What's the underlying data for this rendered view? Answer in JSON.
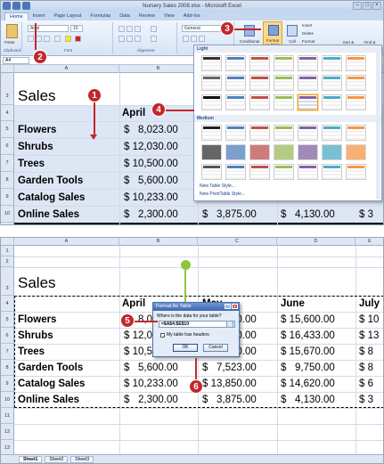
{
  "window": {
    "title": "Nursery Sales 2008.xlsx - Microsoft Excel"
  },
  "tabs": [
    "Home",
    "Insert",
    "Page Layout",
    "Formulas",
    "Data",
    "Review",
    "View",
    "Add-Ins"
  ],
  "ribbon": {
    "paste_label": "Paste",
    "clipboard_group": "Clipboard",
    "font_name": "Arial",
    "font_size": "10",
    "font_group": "Font",
    "alignment_group": "Alignment",
    "number_format": "General",
    "number_group": "Number",
    "conditional_formatting": "Conditional Formatting",
    "format_as_table": "Format as Table",
    "cell_styles": "Cell Styles",
    "insert_label": "Insert",
    "delete_label": "Delete",
    "format_label": "Format",
    "sort_filter": "Sort & Filter",
    "find_select": "Find & Select"
  },
  "formula_bar": {
    "name_box": "A4",
    "fx": "fx"
  },
  "columns": [
    "A",
    "B",
    "C",
    "D",
    "E"
  ],
  "sheet": {
    "title": "Sales",
    "header_row": [
      "April",
      "May",
      "June",
      "July"
    ],
    "rows": [
      {
        "label": "Flowers",
        "values": [
          "$   8,023.00",
          "$ 10,000.00",
          "$ 15,600.00",
          "$ 10"
        ]
      },
      {
        "label": "Shrubs",
        "values": [
          "$ 12,030.00",
          "$ 12,000.00",
          "$ 16,433.00",
          "$ 13"
        ]
      },
      {
        "label": "Trees",
        "values": [
          "$ 10,500.00",
          "$ 10,000.00",
          "$ 15,670.00",
          "$ 8"
        ]
      },
      {
        "label": "Garden Tools",
        "values": [
          "$   5,600.00",
          "$   7,523.00",
          "$   9,750.00",
          "$ 8"
        ]
      },
      {
        "label": "Catalog Sales",
        "values": [
          "$ 10,233.00",
          "$ 13,850.00",
          "$ 14,620.00",
          "$ 6"
        ]
      },
      {
        "label": "Online Sales",
        "values": [
          "$   2,300.00",
          "$   3,875.00",
          "$   4,130.00",
          "$ 3"
        ]
      }
    ]
  },
  "shot1_row_numbers": [
    "3",
    "4",
    "5",
    "6",
    "7",
    "8",
    "9",
    "10"
  ],
  "shot2_row_numbers": [
    "1",
    "2",
    "3",
    "4",
    "5",
    "6",
    "7",
    "8",
    "9",
    "10",
    "11",
    "12",
    "13"
  ],
  "gallery": {
    "light_label": "Light",
    "medium_label": "Medium",
    "new_table_style": "New Table Style...",
    "new_pivot_style": "New PivotTable Style..."
  },
  "dialog": {
    "title": "Format As Table",
    "question": "Where is the data for your table?",
    "range": "=$A$4:$E$10",
    "checkbox_label": "My table has headers",
    "ok": "OK",
    "cancel": "Cancel"
  },
  "sheet_tabs": [
    "Sheet1",
    "Sheet2",
    "Sheet3"
  ],
  "callouts": [
    "1",
    "2",
    "3",
    "4",
    "5",
    "6"
  ],
  "colors": {
    "callout": "#c1272d",
    "accent": "#fcd98a",
    "ribbon": "#d7e4f5"
  }
}
